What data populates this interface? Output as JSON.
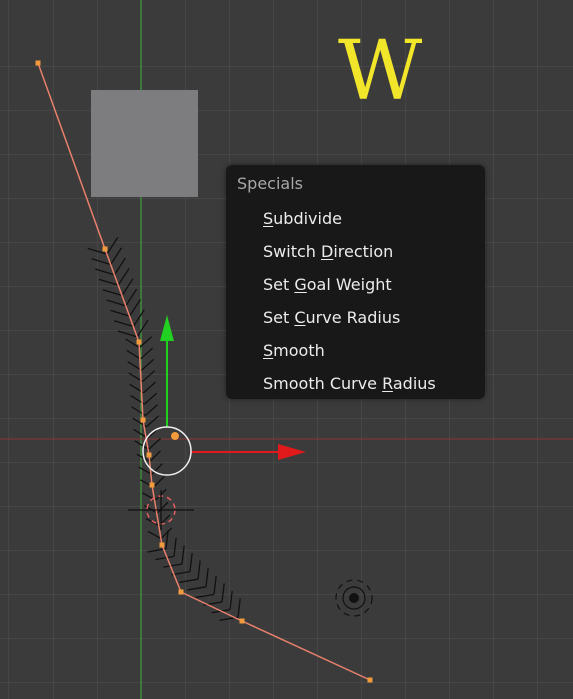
{
  "hotkey_overlay": {
    "letter": "W",
    "color": "#f2e62b"
  },
  "specials_menu": {
    "title": "Specials",
    "items": [
      {
        "label": "Subdivide",
        "mnemonic_index": 0
      },
      {
        "label": "Switch Direction",
        "mnemonic_index": 7
      },
      {
        "label": "Set Goal Weight",
        "mnemonic_index": 4
      },
      {
        "label": "Set Curve Radius",
        "mnemonic_index": 4
      },
      {
        "label": "Smooth",
        "mnemonic_index": 0
      },
      {
        "label": "Smooth Curve Radius",
        "mnemonic_index": 13
      }
    ]
  },
  "colors": {
    "grid_background": "#3b3b3b",
    "grid_line": "#464646",
    "x_axis": "#8a3434",
    "y_axis": "#3c9b3c",
    "curve_line": "#e8806c",
    "control_point": "#f29b3c",
    "normal_hairs": "#111111",
    "gizmo_x": "#e01a1a",
    "gizmo_y": "#22d022",
    "menu_background": "#161616",
    "menu_text": "#ececec",
    "menu_title": "#a8a8a8",
    "object_plane": "#7d7d80"
  },
  "icons": {
    "origin_marker": "camera-origin-icon",
    "cursor_3d": "3d-cursor-icon",
    "light": "lamp-icon"
  }
}
